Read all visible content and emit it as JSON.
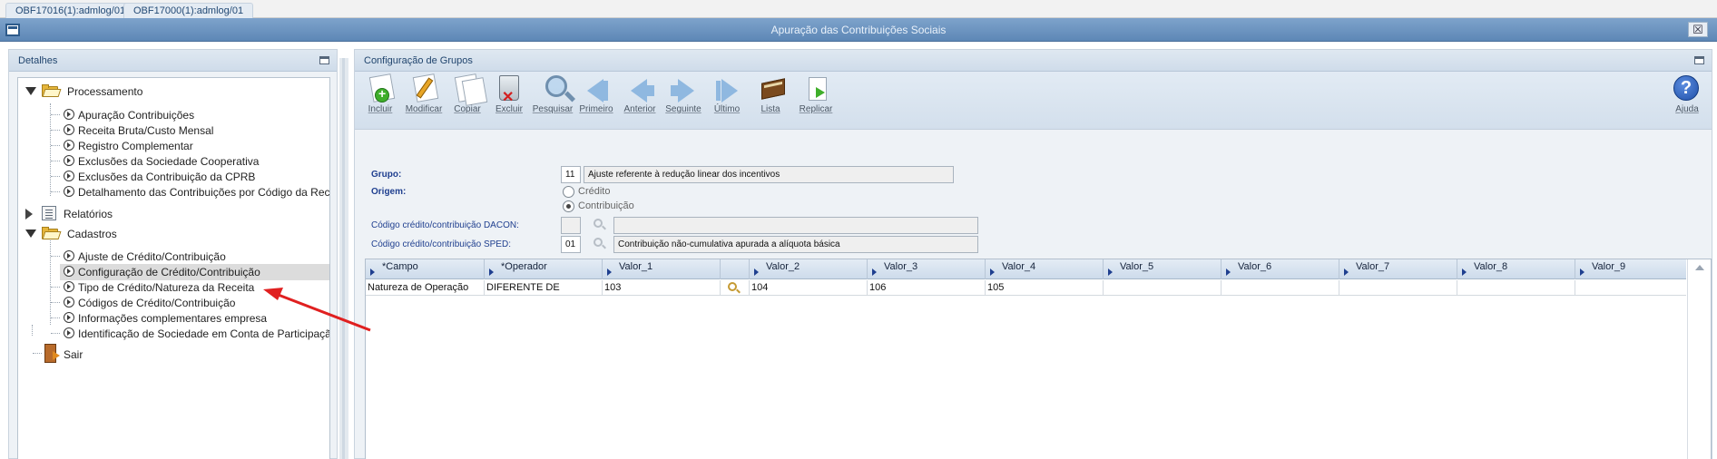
{
  "tabs": [
    "OBF17016(1):admlog/01",
    "OBF17000(1):admlog/01"
  ],
  "window": {
    "title": "Apuração das Contribuições Sociais",
    "close_glyph": "☒"
  },
  "left_panel": {
    "title": "Detalhes",
    "tree": {
      "processamento": {
        "label": "Processamento",
        "items": [
          "Apuração Contribuições",
          "Receita Bruta/Custo Mensal",
          "Registro Complementar",
          "Exclusões da Sociedade Cooperativa",
          "Exclusões da Contribuição da CPRB",
          "Detalhamento das Contribuições por Código da Rece"
        ]
      },
      "relatorios": {
        "label": "Relatórios"
      },
      "cadastros": {
        "label": "Cadastros",
        "items": [
          "Ajuste de Crédito/Contribuição",
          "Configuração de Crédito/Contribuição",
          "Tipo de Crédito/Natureza da Receita",
          "Códigos de Crédito/Contribuição",
          "Informações complementares empresa",
          "Identificação de Sociedade em Conta de Participação"
        ],
        "selected_index": 1
      },
      "sair": {
        "label": "Sair"
      }
    }
  },
  "right_panel": {
    "title": "Configuração de Grupos",
    "toolbar": [
      {
        "key": "incluir",
        "label": "Incluir"
      },
      {
        "key": "modificar",
        "label": "Modificar"
      },
      {
        "key": "copiar",
        "label": "Copiar"
      },
      {
        "key": "excluir",
        "label": "Excluir"
      },
      {
        "key": "pesquisar",
        "label": "Pesquisar"
      },
      {
        "key": "primeiro",
        "label": "Primeiro"
      },
      {
        "key": "anterior",
        "label": "Anterior"
      },
      {
        "key": "seguinte",
        "label": "Seguinte"
      },
      {
        "key": "ultimo",
        "label": "Último"
      },
      {
        "key": "lista",
        "label": "Lista"
      },
      {
        "key": "replicar",
        "label": "Replicar"
      }
    ],
    "help_label": "Ajuda",
    "help_glyph": "?",
    "form": {
      "grupo_label": "Grupo:",
      "grupo_code": "11",
      "grupo_desc": "Ajuste referente à redução linear dos incentivos",
      "origem_label": "Origem:",
      "origem_options": [
        "Crédito",
        "Contribuição"
      ],
      "origem_selected": "Contribuição",
      "dacon_label": "Código crédito/contribuição DACON:",
      "dacon_code": "",
      "dacon_desc": "",
      "sped_label": "Código crédito/contribuição SPED:",
      "sped_code": "01",
      "sped_desc": "Contribuição não-cumulativa apurada a alíquota básica"
    },
    "grid": {
      "columns": [
        "*Campo",
        "*Operador",
        "Valor_1",
        "",
        "Valor_2",
        "Valor_3",
        "Valor_4",
        "Valor_5",
        "Valor_6",
        "Valor_7",
        "Valor_8",
        "Valor_9"
      ],
      "rows": [
        [
          "Natureza de Operação",
          "DIFERENTE DE",
          "103",
          "",
          "104",
          "106",
          "105",
          "",
          "",
          "",
          "",
          ""
        ]
      ]
    }
  },
  "colors": {
    "title_bar": "#6b93c0",
    "panel_header": "#d6e2ee",
    "label_blue": "#1f3f8f",
    "annotation_arrow": "#e02020"
  }
}
